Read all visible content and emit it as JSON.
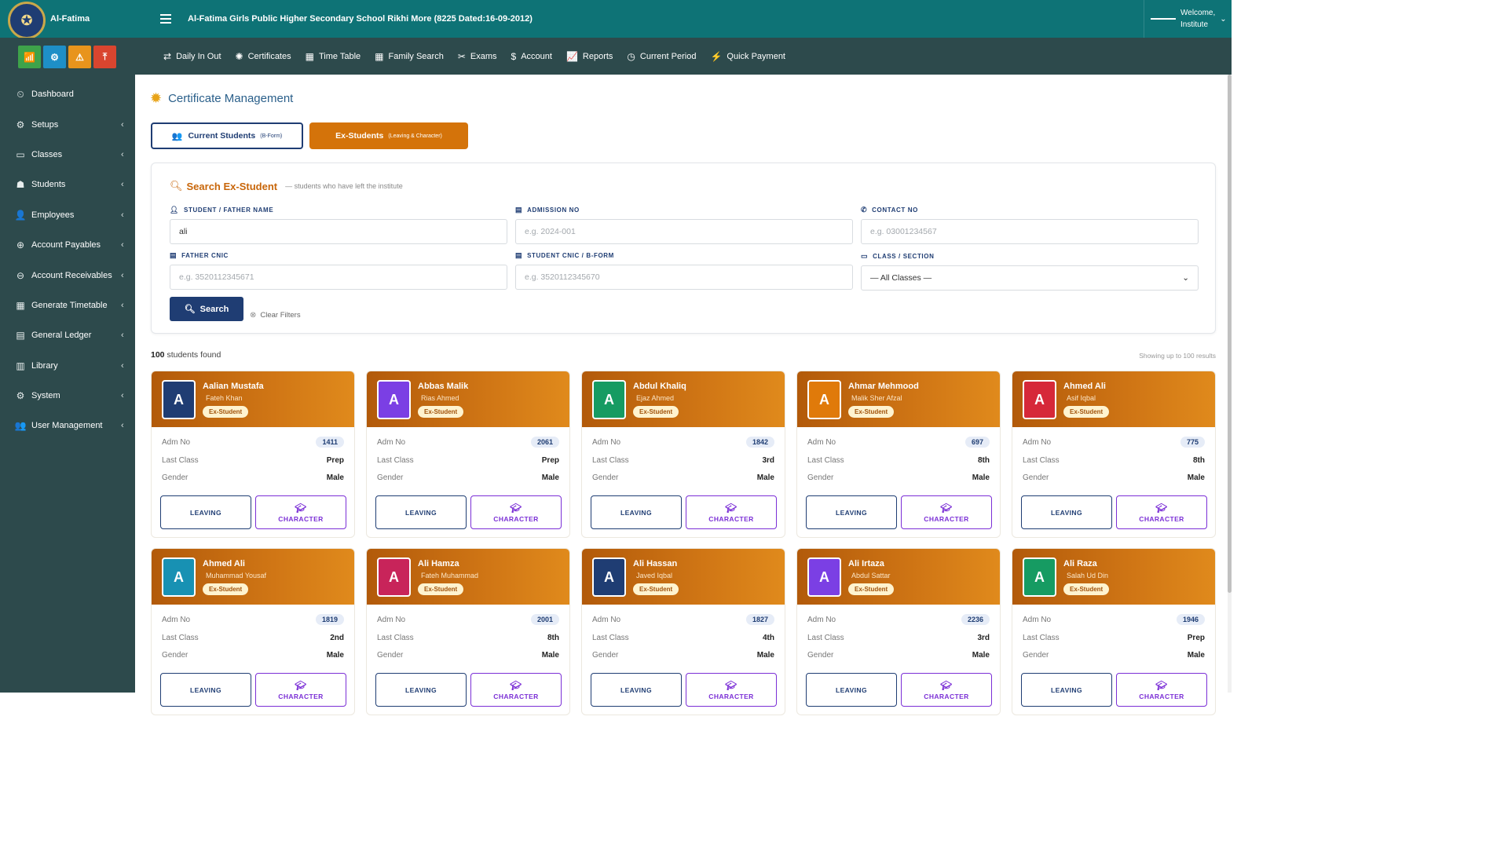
{
  "brand": {
    "name": "Al-Fatima",
    "logo_icon": "school-crest"
  },
  "header": {
    "school_title": "Al-Fatima Girls Public Higher Secondary School Rikhi More (8225 Dated:16-09-2012)",
    "welcome_line1": "Welcome,",
    "welcome_line2": "Institute"
  },
  "quick_icons": [
    {
      "name": "signal-icon",
      "glyph": "📶",
      "color": "#3ea34a"
    },
    {
      "name": "cogs-icon",
      "glyph": "⚙",
      "color": "#1e8fc7"
    },
    {
      "name": "warning-icon",
      "glyph": "⚠",
      "color": "#e8941c"
    },
    {
      "name": "upload-icon",
      "glyph": "⤒",
      "color": "#d9452f"
    }
  ],
  "sidebar": {
    "items": [
      {
        "label": "Dashboard",
        "icon": "⏲",
        "chevron": ""
      },
      {
        "label": "Setups",
        "icon": "⚙",
        "chevron": "‹"
      },
      {
        "label": "Classes",
        "icon": "▭",
        "chevron": "‹"
      },
      {
        "label": "Students",
        "icon": "☗",
        "chevron": "‹"
      },
      {
        "label": "Employees",
        "icon": "👤",
        "chevron": "‹"
      },
      {
        "label": "Account Payables",
        "icon": "⊕",
        "chevron": "‹"
      },
      {
        "label": "Account Receivables",
        "icon": "⊖",
        "chevron": "‹"
      },
      {
        "label": "Generate Timetable",
        "icon": "▦",
        "chevron": "‹"
      },
      {
        "label": "General Ledger",
        "icon": "▤",
        "chevron": "‹"
      },
      {
        "label": "Library",
        "icon": "▥",
        "chevron": "‹"
      },
      {
        "label": "System",
        "icon": "⚙",
        "chevron": "‹"
      },
      {
        "label": "User Management",
        "icon": "👥",
        "chevron": "‹"
      }
    ]
  },
  "navbar": {
    "items": [
      {
        "label": "Daily In Out",
        "icon": "⇄"
      },
      {
        "label": "Certificates",
        "icon": "✺"
      },
      {
        "label": "Time Table",
        "icon": "▦"
      },
      {
        "label": "Family Search",
        "icon": "▦"
      },
      {
        "label": "Exams",
        "icon": "✂"
      },
      {
        "label": "Account",
        "icon": "$"
      },
      {
        "label": "Reports",
        "icon": "📈"
      },
      {
        "label": "Current Period",
        "icon": "◷"
      },
      {
        "label": "Quick Payment",
        "icon": "⚡"
      }
    ]
  },
  "page": {
    "title": "Certificate Management",
    "title_icon": "✹"
  },
  "tabs": {
    "current_label": "Current Students",
    "current_sub": "(B-Form)",
    "ex_label": "Ex-Students",
    "ex_sub": "(Leaving & Character)"
  },
  "search": {
    "title": "Search Ex-Student",
    "subtitle": "— students who have left the institute",
    "fields": {
      "name_label": "STUDENT / FATHER NAME",
      "name_value": "ali",
      "admission_label": "ADMISSION NO",
      "admission_placeholder": "e.g. 2024-001",
      "contact_label": "CONTACT NO",
      "contact_placeholder": "e.g. 03001234567",
      "father_cnic_label": "FATHER CNIC",
      "father_cnic_placeholder": "e.g. 3520112345671",
      "student_cnic_label": "STUDENT CNIC / B-FORM",
      "student_cnic_placeholder": "e.g. 3520112345670",
      "class_label": "CLASS / SECTION",
      "class_value": "— All Classes —"
    },
    "search_button": "Search",
    "clear_filters": "Clear Filters"
  },
  "results": {
    "count": "100",
    "count_suffix": "students found",
    "note": "Showing up to 100 results"
  },
  "card_labels": {
    "adm_no": "Adm No",
    "last_class": "Last Class",
    "gender": "Gender",
    "badge": "Ex-Student",
    "leaving_button": "LEAVING",
    "character_button": "CHARACTER"
  },
  "students": [
    {
      "initial": "A",
      "name": "Aalian Mustafa",
      "father": "Fateh Khan",
      "adm_no": "1411",
      "last_class": "Prep",
      "gender": "Male",
      "avatar_color": "#1f3d73"
    },
    {
      "initial": "A",
      "name": "Abbas Malik",
      "father": "Rias Ahmed",
      "adm_no": "2061",
      "last_class": "Prep",
      "gender": "Male",
      "avatar_color": "#7b3fe4"
    },
    {
      "initial": "A",
      "name": "Abdul Khaliq",
      "father": "Ejaz Ahmed",
      "adm_no": "1842",
      "last_class": "3rd",
      "gender": "Male",
      "avatar_color": "#169b62"
    },
    {
      "initial": "A",
      "name": "Ahmar Mehmood",
      "father": "Malik Sher Afzal",
      "adm_no": "697",
      "last_class": "8th",
      "gender": "Male",
      "avatar_color": "#e07a0a"
    },
    {
      "initial": "A",
      "name": "Ahmed Ali",
      "father": "Asif Iqbal",
      "adm_no": "775",
      "last_class": "8th",
      "gender": "Male",
      "avatar_color": "#d62839"
    },
    {
      "initial": "A",
      "name": "Ahmed Ali",
      "father": "Muhammad Yousaf",
      "adm_no": "1819",
      "last_class": "2nd",
      "gender": "Male",
      "avatar_color": "#1891b3"
    },
    {
      "initial": "A",
      "name": "Ali Hamza",
      "father": "Fateh Muhammad",
      "adm_no": "2001",
      "last_class": "8th",
      "gender": "Male",
      "avatar_color": "#c8245a"
    },
    {
      "initial": "A",
      "name": "Ali Hassan",
      "father": "Javed Iqbal",
      "adm_no": "1827",
      "last_class": "4th",
      "gender": "Male",
      "avatar_color": "#1f3d73"
    },
    {
      "initial": "A",
      "name": "Ali Irtaza",
      "father": "Abdul Sattar",
      "adm_no": "2236",
      "last_class": "3rd",
      "gender": "Male",
      "avatar_color": "#7b3fe4"
    },
    {
      "initial": "A",
      "name": "Ali Raza",
      "father": "Salah Ud Din",
      "adm_no": "1946",
      "last_class": "Prep",
      "gender": "Male",
      "avatar_color": "#169b62"
    }
  ]
}
